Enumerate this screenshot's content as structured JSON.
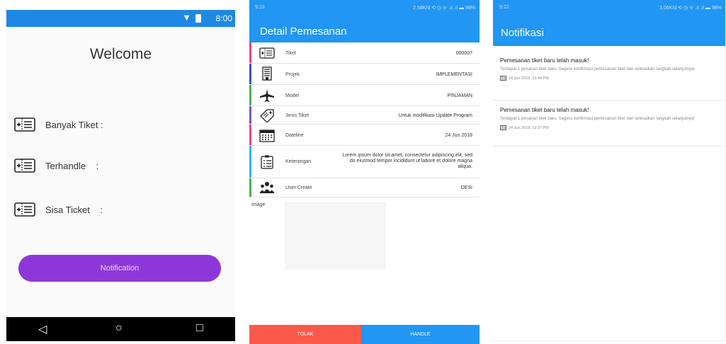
{
  "screen1": {
    "status_time": "8:00",
    "title": "Welcome",
    "stats": [
      {
        "label": "Banyak Tiket :"
      },
      {
        "label": "Terhandle    :"
      },
      {
        "label": "Sisa Ticket    :"
      }
    ],
    "notification_button": "Notification",
    "nav": {
      "back": "◁",
      "home": "○",
      "recent": "□"
    },
    "colors": {
      "status": "#1e88e5",
      "button": "#8e37d9"
    }
  },
  "screen2": {
    "status_time": "9:13",
    "status_right": "2,58K/d ⟲ ◷ ᯤ .ıl .ıl ▬ 98%",
    "title": "Detail Pemesanan",
    "rows": [
      {
        "key": "Tiket",
        "value": "000007",
        "icon": "ticket-icon",
        "color": "#e84393"
      },
      {
        "key": "Projek",
        "value": "IMPLEMENTASI",
        "icon": "building-icon",
        "color": "#3f51b5"
      },
      {
        "key": "Model",
        "value": "PINJAMAN",
        "icon": "airplane-icon",
        "color": "#4caf50"
      },
      {
        "key": "Jenis Tiket",
        "value": "Untuk modifikasi Update Program",
        "icon": "tag-icon",
        "color": "#7e57c2"
      },
      {
        "key": "Dateline",
        "value": "24 Jun 2018",
        "icon": "calendar-icon",
        "color": "#e84393"
      },
      {
        "key": "Keterangan",
        "value": "Lorem ipsum dolor sit amet, consectetur adipiscing elit, sed do eiusmod tempor incididunt ut labore et dolore magna aliqua.",
        "icon": "clipboard-icon",
        "color": "#29b6f6"
      },
      {
        "key": "User Create",
        "value": "DESI",
        "icon": "users-icon",
        "color": "#4caf50"
      }
    ],
    "image_label": "Image",
    "tolak_button": "TOLAK",
    "handle_button": "HANDLE",
    "colors": {
      "primary": "#2196f3",
      "reject": "#fb5a4a"
    }
  },
  "screen3": {
    "status_time": "9:12",
    "status_right": "3,06K/d ⟲ ◷ ᯤ .ıl .ıl ▬ 98%",
    "title": "Notifikasi",
    "notifications": [
      {
        "title": "Pemesanan tiket baru telah masuk!",
        "body": "Terdapat 1 pesanan tiket baru. Segera konfirmasi pemesanan tiket dan selesaikan langkah selanjutnya!",
        "date": "24 Jun 2018, 13:44 PM"
      },
      {
        "title": "Pemesanan tiket baru telah masuk!",
        "body": "Terdapat 1 pesanan tiket baru. Segera konfirmasi pemesanan tiket dan selesaikan langkah selanjutnya!",
        "date": "24 Jun 2018, 13:37 PM"
      }
    ]
  }
}
